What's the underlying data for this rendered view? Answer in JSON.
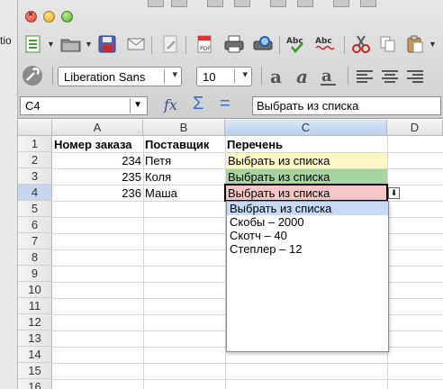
{
  "background": {
    "left_text": "tio"
  },
  "titlebar": {
    "controls": [
      "close",
      "minimize",
      "zoom"
    ]
  },
  "toolbar": {
    "font_name": "Liberation Sans",
    "font_size": "10",
    "icons": [
      "new-document-icon",
      "open-folder-icon",
      "save-icon",
      "email-icon",
      "edit-file-icon",
      "export-pdf-icon",
      "print-icon",
      "print-preview-icon",
      "spellcheck-icon",
      "autospellcheck-icon",
      "cut-icon",
      "copy-icon",
      "paste-icon"
    ]
  },
  "formula_bar": {
    "name_box": "C4",
    "formula": "Выбрать из списка"
  },
  "columns": [
    "A",
    "B",
    "C",
    "D"
  ],
  "rows": [
    "1",
    "2",
    "3",
    "4",
    "5",
    "6",
    "7",
    "8",
    "9",
    "10",
    "11",
    "12",
    "13",
    "14",
    "15",
    "16"
  ],
  "cells": {
    "A1": "Номер заказа",
    "B1": "Поставщик",
    "C1": "Перечень",
    "A2": "234",
    "B2": "Петя",
    "C2": "Выбрать из списка",
    "A3": "235",
    "B3": "Коля",
    "C3": "Выбрать из списка",
    "A4": "236",
    "B4": "Маша",
    "C4": "Выбрать из списка"
  },
  "colors": {
    "C2": "#fcf7c5",
    "C3": "#a6d5a0",
    "C4": "#f7c6c6",
    "selection_blue": "#c6d9f5"
  },
  "dropdown": {
    "options": [
      "Выбрать из списка",
      "Скобы – 2000",
      "Скотч – 40",
      "Степлер – 12"
    ],
    "highlighted_index": 0
  }
}
